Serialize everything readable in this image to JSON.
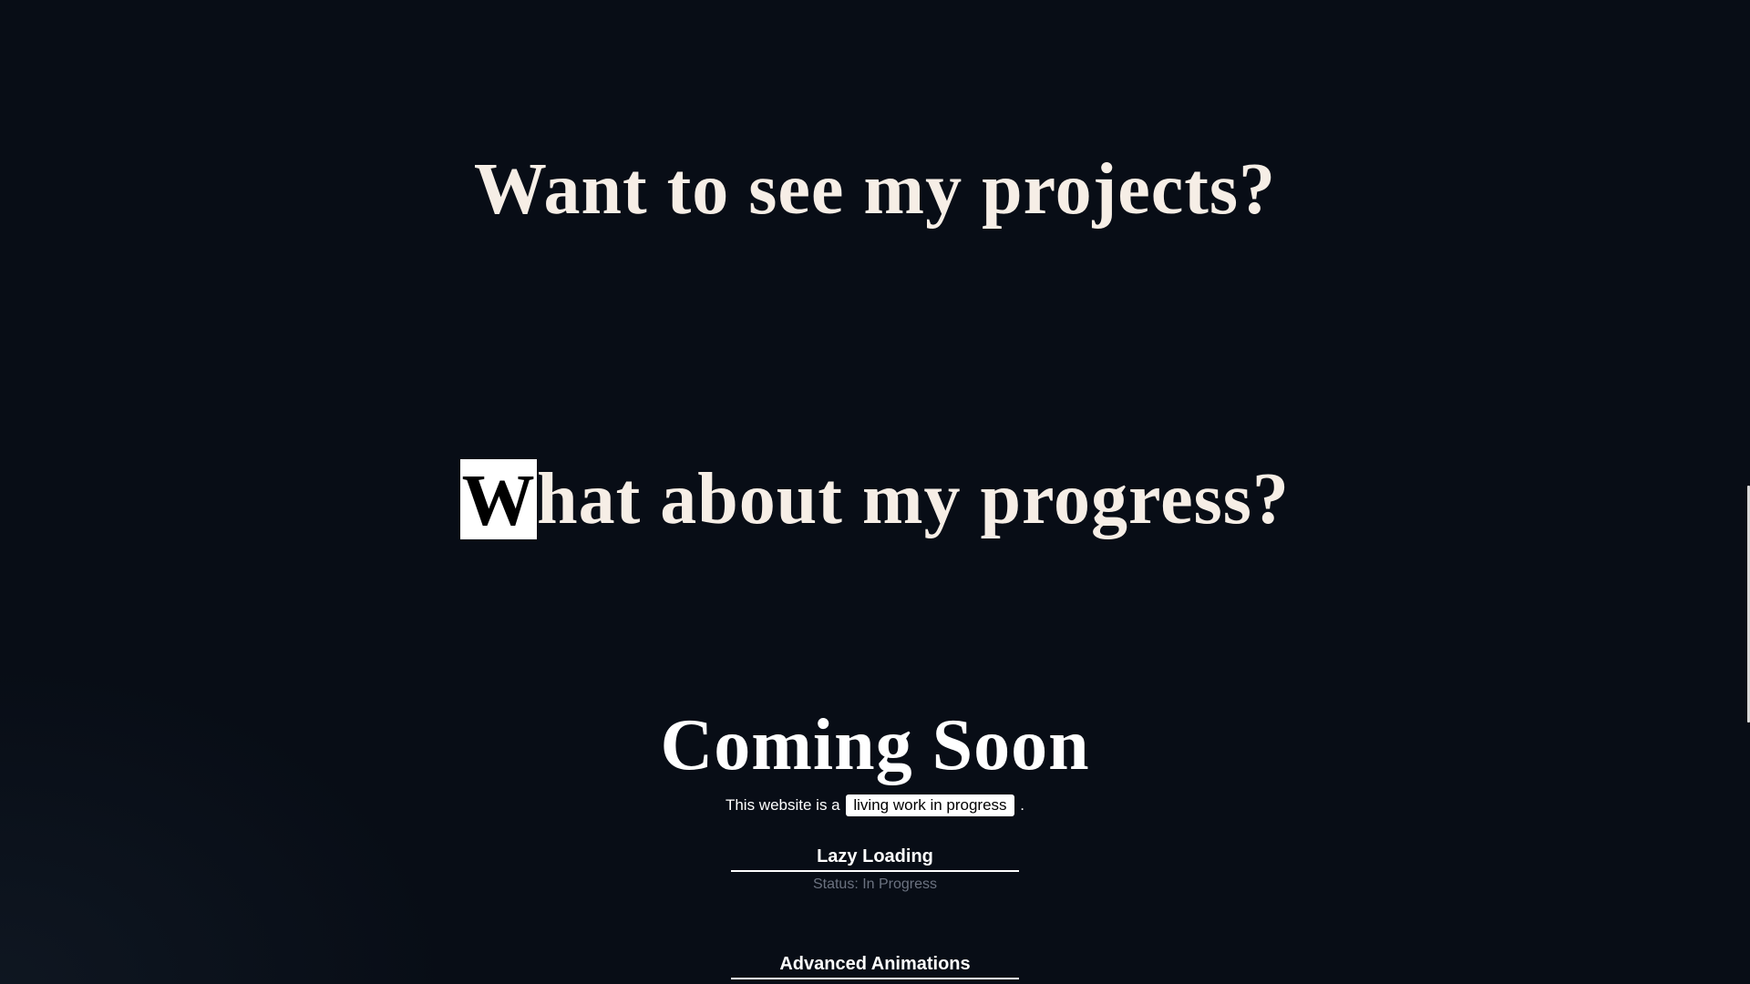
{
  "sections": {
    "projects_heading": "Want to see my projects?",
    "progress_heading": {
      "highlighted_letter": "W",
      "rest": "hat about my progress?"
    },
    "coming_soon": "Coming Soon"
  },
  "intro": {
    "prefix": "This website is a",
    "pill": "living work in progress",
    "suffix": "."
  },
  "features": [
    {
      "title": "Lazy Loading",
      "status": "Status: In Progress"
    },
    {
      "title": "Advanced Animations"
    }
  ],
  "colors": {
    "background": "#080d16",
    "heading": "#f6eee6",
    "status": "#6b7280"
  }
}
